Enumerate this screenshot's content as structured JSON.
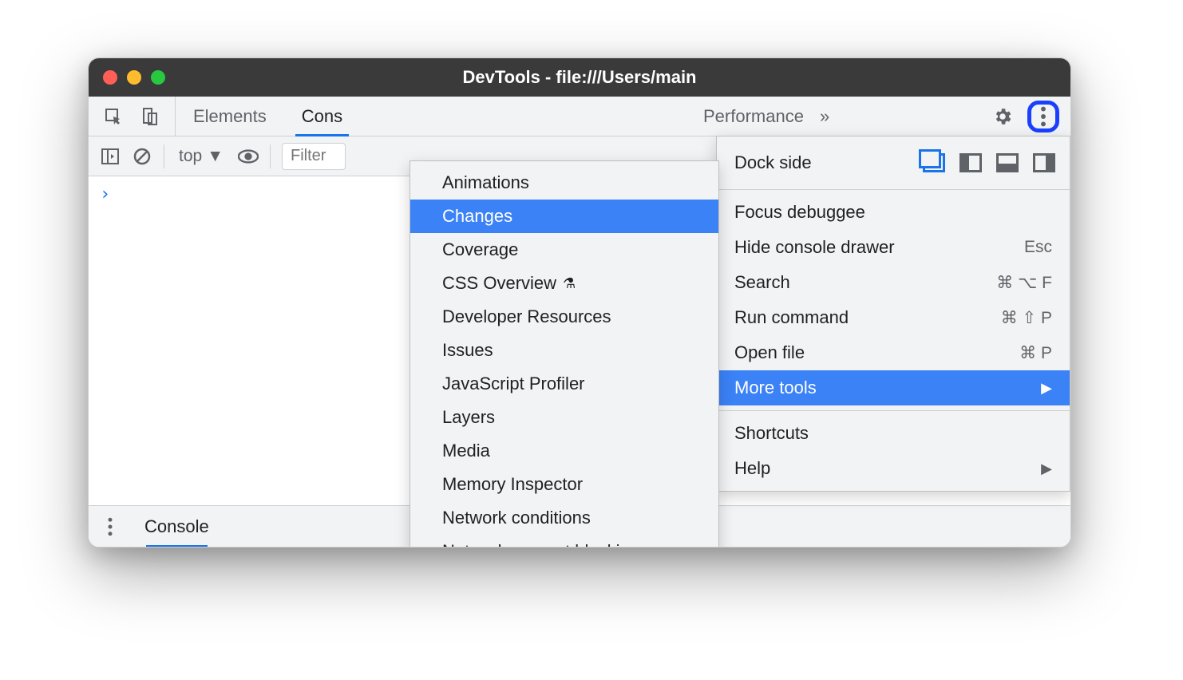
{
  "window": {
    "title": "DevTools - file:///Users/main"
  },
  "tabs": {
    "elements": "Elements",
    "console_truncated": "Cons",
    "performance_partial": "Performance",
    "overflow": "»"
  },
  "toolbar": {
    "context": "top",
    "filter_placeholder": "Filter"
  },
  "console": {
    "prompt": "›"
  },
  "drawer": {
    "label": "Console"
  },
  "main_menu": {
    "dock_side": "Dock side",
    "focus_debuggee": "Focus debuggee",
    "hide_console_drawer": "Hide console drawer",
    "hide_console_drawer_shortcut": "Esc",
    "search": "Search",
    "search_shortcut": "⌘ ⌥ F",
    "run_command": "Run command",
    "run_command_shortcut": "⌘ ⇧ P",
    "open_file": "Open file",
    "open_file_shortcut": "⌘ P",
    "more_tools": "More tools",
    "shortcuts": "Shortcuts",
    "help": "Help"
  },
  "more_tools_submenu": {
    "animations": "Animations",
    "changes": "Changes",
    "coverage": "Coverage",
    "css_overview": "CSS Overview",
    "developer_resources": "Developer Resources",
    "issues": "Issues",
    "javascript_profiler": "JavaScript Profiler",
    "layers": "Layers",
    "media": "Media",
    "memory_inspector": "Memory Inspector",
    "network_conditions": "Network conditions",
    "network_request_blocking": "Network request blocking"
  }
}
